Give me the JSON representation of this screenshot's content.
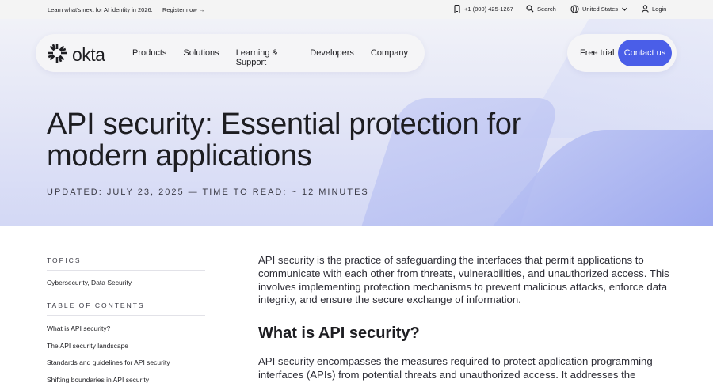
{
  "utility": {
    "promo": "Learn what's next for AI identity in 2026.",
    "register": "Register now →",
    "phone": "+1 (800) 425-1267",
    "search": "Search",
    "region": "United States",
    "login": "Login"
  },
  "nav": {
    "logo": "okta",
    "links": [
      "Products",
      "Solutions",
      "Learning & Support",
      "Developers",
      "Company"
    ],
    "free_trial": "Free trial",
    "contact": "Contact us"
  },
  "hero": {
    "title": "API security: Essential protection for modern applications",
    "meta": "UPDATED: JULY 23, 2025 — TIME TO READ: ~ 12 MINUTES"
  },
  "sidebar": {
    "topics_heading": "TOPICS",
    "topics": "Cybersecurity, Data Security",
    "toc_heading": "TABLE OF CONTENTS",
    "toc": [
      "What is API security?",
      "The API security landscape",
      "Standards and guidelines for API security",
      "Shifting boundaries in API security"
    ]
  },
  "main": {
    "intro": "API security is the practice of safeguarding the interfaces that permit applications to communicate with each other from threats, vulnerabilities, and unauthorized access. This involves implementing protection mechanisms to prevent malicious attacks, enforce data integrity, and ensure the secure exchange of information.",
    "section_title": "What is API security?",
    "section_body": "API security encompasses the measures required to protect application programming interfaces (APIs) from potential threats and unauthorized access. It addresses the following core areas:"
  },
  "colors": {
    "accent": "#4a5ee8",
    "hero_bg": "#dfe2f6"
  },
  "icons": {
    "phone": "phone-icon",
    "search": "search-icon",
    "globe": "globe-icon",
    "chevron": "chevron-down-icon",
    "user": "user-icon",
    "logo": "okta-logo-icon"
  }
}
